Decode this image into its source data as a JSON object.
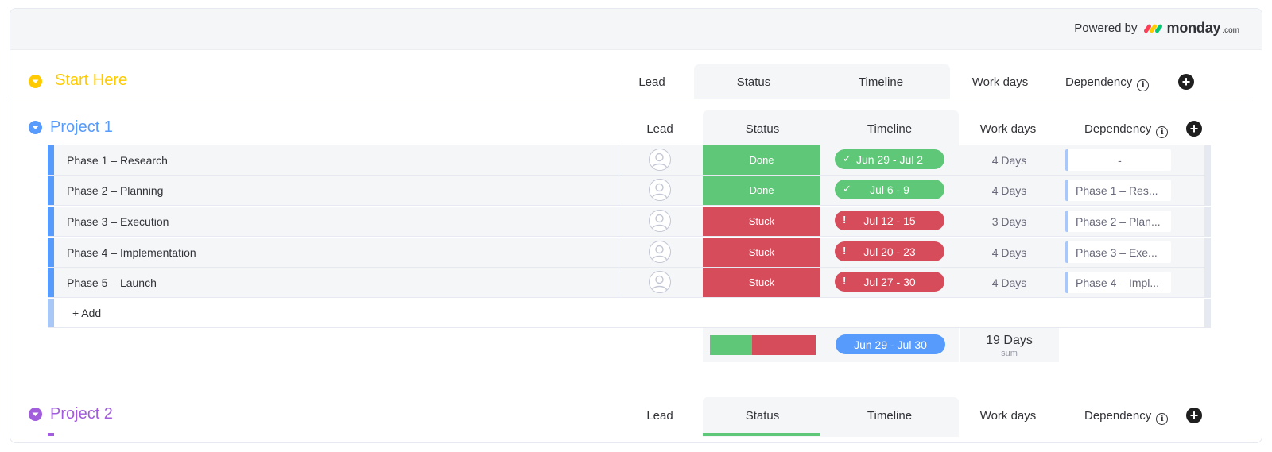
{
  "header": {
    "powered_by": "Powered by",
    "brand": "monday",
    "brand_suffix": ".com",
    "brand_colors": [
      "#ff3d57",
      "#ffcb00",
      "#00ca72"
    ]
  },
  "columns": {
    "lead": "Lead",
    "status": "Status",
    "timeline": "Timeline",
    "work_days": "Work days",
    "dependency": "Dependency",
    "info_glyph": "i",
    "add_glyph": "+"
  },
  "groups": {
    "start": {
      "title": "Start Here",
      "color": "#ffcb00"
    },
    "project1": {
      "title": "Project 1",
      "color": "#579bfc",
      "add_label": "+ Add",
      "items": [
        {
          "name": "Phase 1 – Research",
          "status": "Done",
          "status_color": "#5fc878",
          "timeline": "Jun 29 - Jul 2",
          "timeline_mark": "✓",
          "timeline_color": "#5fc878",
          "work_days": "4 Days",
          "dependency": "-"
        },
        {
          "name": "Phase 2 – Planning",
          "status": "Done",
          "status_color": "#5fc878",
          "timeline": "Jul 6 - 9",
          "timeline_mark": "✓",
          "timeline_color": "#5fc878",
          "work_days": "4 Days",
          "dependency": "Phase 1 – Res..."
        },
        {
          "name": "Phase 3 – Execution",
          "status": "Stuck",
          "status_color": "#d64c5b",
          "timeline": "Jul 12 - 15",
          "timeline_mark": "!",
          "timeline_color": "#d64c5b",
          "work_days": "3 Days",
          "dependency": "Phase 2 – Plan..."
        },
        {
          "name": "Phase 4 – Implementation",
          "status": "Stuck",
          "status_color": "#d64c5b",
          "timeline": "Jul 20 - 23",
          "timeline_mark": "!",
          "timeline_color": "#d64c5b",
          "work_days": "4 Days",
          "dependency": "Phase 3 – Exe..."
        },
        {
          "name": "Phase 5 – Launch",
          "status": "Stuck",
          "status_color": "#d64c5b",
          "timeline": "Jul 27 - 30",
          "timeline_mark": "!",
          "timeline_color": "#d64c5b",
          "work_days": "4 Days",
          "dependency": "Phase 4 – Impl..."
        }
      ],
      "summary": {
        "status_breakdown": [
          {
            "label": "Done",
            "fraction": 0.4,
            "color": "#5fc878"
          },
          {
            "label": "Stuck",
            "fraction": 0.6,
            "color": "#d64c5b"
          }
        ],
        "timeline": "Jun 29 - Jul 30",
        "work_days": "19 Days",
        "work_days_caption": "sum"
      }
    },
    "project2": {
      "title": "Project 2",
      "color": "#a25ddc"
    }
  }
}
